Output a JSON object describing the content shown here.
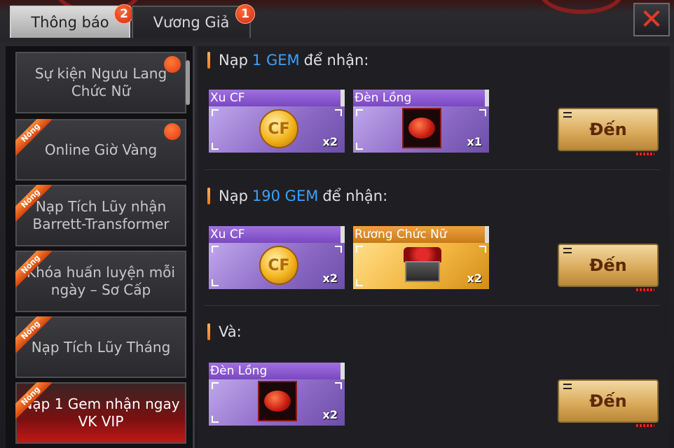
{
  "tabs": [
    {
      "label": "Thông báo",
      "badge": "2"
    },
    {
      "label": "Vương Giả",
      "badge": "1"
    }
  ],
  "close_label": "✕",
  "sidebar": {
    "items": [
      {
        "label": "Sự kiện Ngưu Lang Chức Nữ",
        "hot": false,
        "dot": true
      },
      {
        "label": "Online Giờ Vàng",
        "hot": true,
        "dot": true
      },
      {
        "label": "Nạp Tích Lũy nhận Barrett-Transformer",
        "hot": true,
        "dot": false
      },
      {
        "label": "Khóa huấn luyện mỗi ngày – Sơ Cấp",
        "hot": true,
        "dot": false
      },
      {
        "label": "Nạp Tích Lũy Tháng",
        "hot": true,
        "dot": false
      },
      {
        "label": "Nạp 1 Gem nhận ngay VK VIP",
        "hot": true,
        "dot": false
      }
    ],
    "hot_label": "Nóng"
  },
  "sections": [
    {
      "prefix": "Nạp",
      "amount": "1 GEM",
      "suffix": "để nhận:",
      "rewards": [
        {
          "title": "Xu CF",
          "qty": "x2",
          "icon": "cf-coin-icon",
          "style": "purple"
        },
        {
          "title": "Đèn Lồng",
          "qty": "x1",
          "icon": "lantern-icon",
          "style": "purple"
        }
      ],
      "button": "Đến"
    },
    {
      "prefix": "Nạp",
      "amount": "190 GEM",
      "suffix": "để nhận:",
      "rewards": [
        {
          "title": "Xu CF",
          "qty": "x2",
          "icon": "cf-coin-icon",
          "style": "purple"
        },
        {
          "title": "Rương Chức Nữ",
          "qty": "x2",
          "icon": "chest-icon",
          "style": "gold"
        }
      ],
      "button": "Đến"
    },
    {
      "prefix": "Và:",
      "amount": "",
      "suffix": "",
      "rewards": [
        {
          "title": "Đèn Lồng",
          "qty": "x2",
          "icon": "lantern-icon",
          "style": "purple"
        }
      ],
      "button": "Đến"
    }
  ],
  "colors": {
    "accent": "#3aa0ff",
    "badge": "#d22a10",
    "selected": "#c01818"
  }
}
